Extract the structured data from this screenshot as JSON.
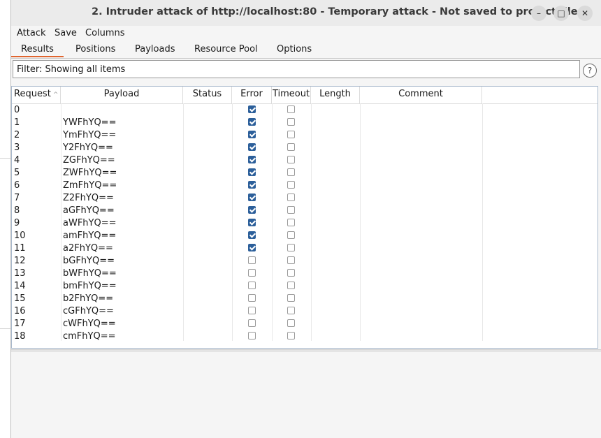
{
  "window": {
    "title": "2. Intruder attack of http://localhost:80 - Temporary attack - Not saved to project file",
    "minimize_glyph": "–",
    "maximize_glyph": "□",
    "close_glyph": "✕"
  },
  "menu": [
    "Attack",
    "Save",
    "Columns"
  ],
  "tabs": [
    "Results",
    "Positions",
    "Payloads",
    "Resource Pool",
    "Options"
  ],
  "active_tab": "Results",
  "filter": {
    "text": "Filter: Showing all items",
    "help_glyph": "?"
  },
  "table": {
    "columns": [
      "Request",
      "Payload",
      "Status",
      "Error",
      "Timeout",
      "Length",
      "Comment"
    ],
    "sort_column": "Request",
    "sort_glyph": "^",
    "rows": [
      {
        "request": "0",
        "payload": "",
        "status": "",
        "error": true,
        "timeout": false,
        "length": "",
        "comment": ""
      },
      {
        "request": "1",
        "payload": "YWFhYQ==",
        "status": "",
        "error": true,
        "timeout": false,
        "length": "",
        "comment": ""
      },
      {
        "request": "2",
        "payload": "YmFhYQ==",
        "status": "",
        "error": true,
        "timeout": false,
        "length": "",
        "comment": ""
      },
      {
        "request": "3",
        "payload": "Y2FhYQ==",
        "status": "",
        "error": true,
        "timeout": false,
        "length": "",
        "comment": ""
      },
      {
        "request": "4",
        "payload": "ZGFhYQ==",
        "status": "",
        "error": true,
        "timeout": false,
        "length": "",
        "comment": ""
      },
      {
        "request": "5",
        "payload": "ZWFhYQ==",
        "status": "",
        "error": true,
        "timeout": false,
        "length": "",
        "comment": ""
      },
      {
        "request": "6",
        "payload": "ZmFhYQ==",
        "status": "",
        "error": true,
        "timeout": false,
        "length": "",
        "comment": ""
      },
      {
        "request": "7",
        "payload": "Z2FhYQ==",
        "status": "",
        "error": true,
        "timeout": false,
        "length": "",
        "comment": ""
      },
      {
        "request": "8",
        "payload": "aGFhYQ==",
        "status": "",
        "error": true,
        "timeout": false,
        "length": "",
        "comment": ""
      },
      {
        "request": "9",
        "payload": "aWFhYQ==",
        "status": "",
        "error": true,
        "timeout": false,
        "length": "",
        "comment": ""
      },
      {
        "request": "10",
        "payload": "amFhYQ==",
        "status": "",
        "error": true,
        "timeout": false,
        "length": "",
        "comment": ""
      },
      {
        "request": "11",
        "payload": "a2FhYQ==",
        "status": "",
        "error": true,
        "timeout": false,
        "length": "",
        "comment": ""
      },
      {
        "request": "12",
        "payload": "bGFhYQ==",
        "status": "",
        "error": false,
        "timeout": false,
        "length": "",
        "comment": ""
      },
      {
        "request": "13",
        "payload": "bWFhYQ==",
        "status": "",
        "error": false,
        "timeout": false,
        "length": "",
        "comment": ""
      },
      {
        "request": "14",
        "payload": "bmFhYQ==",
        "status": "",
        "error": false,
        "timeout": false,
        "length": "",
        "comment": ""
      },
      {
        "request": "15",
        "payload": "b2FhYQ==",
        "status": "",
        "error": false,
        "timeout": false,
        "length": "",
        "comment": ""
      },
      {
        "request": "16",
        "payload": "cGFhYQ==",
        "status": "",
        "error": false,
        "timeout": false,
        "length": "",
        "comment": ""
      },
      {
        "request": "17",
        "payload": "cWFhYQ==",
        "status": "",
        "error": false,
        "timeout": false,
        "length": "",
        "comment": ""
      },
      {
        "request": "18",
        "payload": "cmFhYQ==",
        "status": "",
        "error": false,
        "timeout": false,
        "length": "",
        "comment": ""
      }
    ]
  },
  "colors": {
    "accent": "#e0652f",
    "checkbox_checked": "#2c5f9a"
  }
}
